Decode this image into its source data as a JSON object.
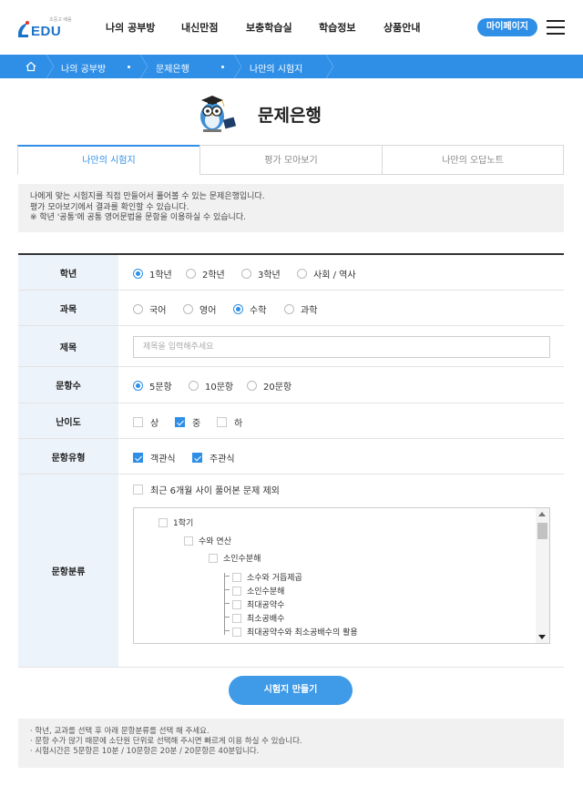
{
  "header": {
    "logo_sub": "초중고 배움",
    "logo_text": "EDU",
    "nav": [
      "나의 공부방",
      "내신만점",
      "보충학습실",
      "학습정보",
      "상품안내"
    ],
    "mypage_label": "마이페이지"
  },
  "breadcrumb": [
    "나의 공부방",
    "문제은행",
    "나만의 시험지"
  ],
  "page_title": "문제은행",
  "tabs": [
    "나만의 시험지",
    "평가 모아보기",
    "나만의 오답노트"
  ],
  "notice": [
    "나에게 맞는 시험지를 직접 만들어서 풀어볼 수 있는 문제은행입니다.",
    "평가 모아보기에서 결과를 확인할 수 있습니다.",
    "※ 학년 '공통'에 공통 영어문법을 문항을 이용하실 수 있습니다."
  ],
  "form": {
    "grade": {
      "label": "학년",
      "options": [
        "1학년",
        "2학년",
        "3학년",
        "사회 / 역사"
      ],
      "selected": 0
    },
    "subject": {
      "label": "과목",
      "options": [
        "국어",
        "영어",
        "수학",
        "과학"
      ],
      "selected": 2
    },
    "title": {
      "label": "제목",
      "placeholder": "제목을 입력해주세요",
      "value": ""
    },
    "count": {
      "label": "문항수",
      "options": [
        "5문항",
        "10문항",
        "20문항"
      ],
      "selected": 0
    },
    "difficulty": {
      "label": "난이도",
      "options": [
        "상",
        "중",
        "하"
      ],
      "checked": [
        false,
        true,
        false
      ]
    },
    "type": {
      "label": "문항유형",
      "options": [
        "객관식",
        "주관식"
      ],
      "checked": [
        true,
        true
      ]
    },
    "category": {
      "label": "문항분류",
      "exclude_label": "최근 6개월 사이 풀어본 문제 제외",
      "tree": {
        "level1": "1학기",
        "level2": "수와 연산",
        "level3": "소인수분해",
        "leaves": [
          "소수와 거듭제곱",
          "소인수분해",
          "최대공약수",
          "최소공배수",
          "최대공약수와 최소공배수의 활용"
        ]
      }
    }
  },
  "submit_label": "시험지 만들기",
  "notes": [
    "· 학년, 교과를 선택 후 아래 문항분류를 선택 해 주세요.",
    "· 문항 수가 많기 때문에 소단원 단위로 선택해 주시면 빠르게 이용 하실 수 있습니다.",
    "· 시험시간은 5문항은 10분 / 10문항은 20분 / 20문항은 40분입니다."
  ],
  "colors": {
    "accent": "#2f8fe6",
    "label_bg": "#edf3fb",
    "notice_bg": "#f1f1f1"
  }
}
